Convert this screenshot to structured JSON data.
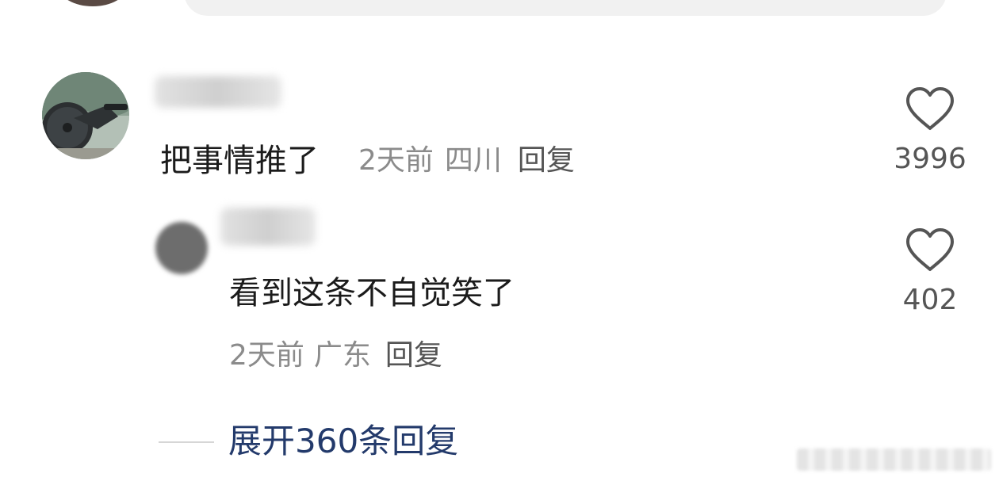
{
  "comment": {
    "text": "把事情推了",
    "time": "2天前",
    "location": "四川",
    "reply_label": "回复",
    "likes": "3996"
  },
  "reply": {
    "text": "看到这条不自觉笑了",
    "time": "2天前",
    "location": "广东",
    "reply_label": "回复",
    "likes": "402"
  },
  "expand": {
    "label": "展开360条回复"
  },
  "colors": {
    "link": "#233a6b",
    "meta": "#8b8b8b",
    "text": "#1b1b1b"
  }
}
